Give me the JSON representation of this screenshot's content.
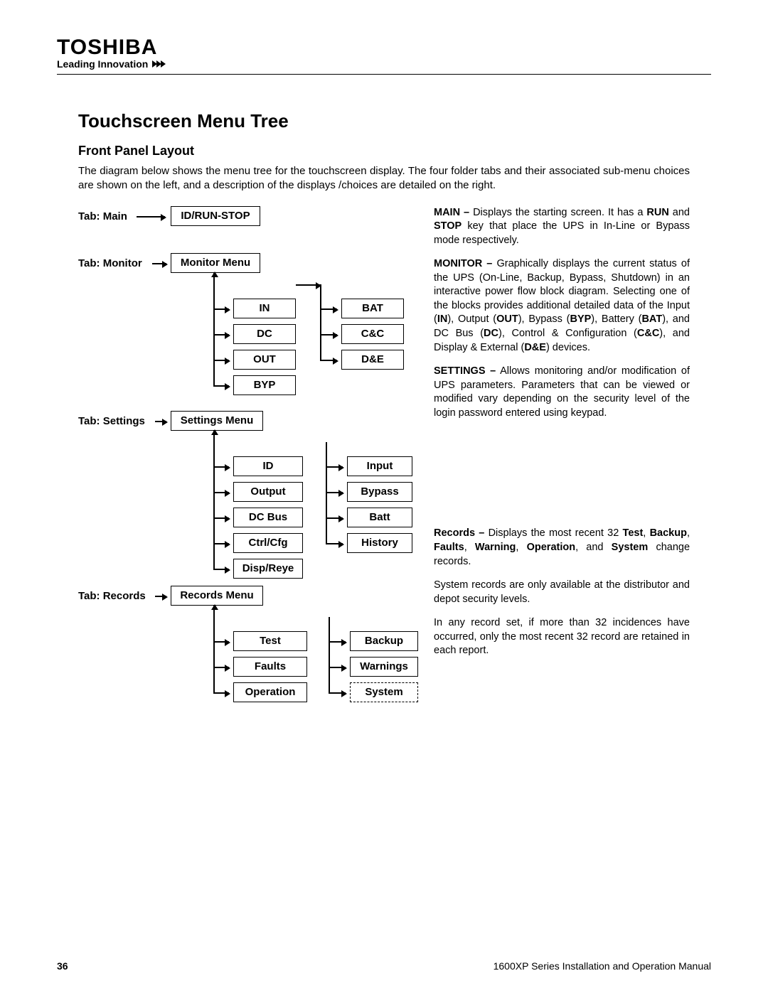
{
  "brand": "TOSHIBA",
  "tagline": "Leading Innovation",
  "title": "Touchscreen Menu Tree",
  "subtitle": "Front Panel Layout",
  "intro": "The diagram below shows the menu tree for the touchscreen display. The four folder tabs and their associated sub-menu choices are shown on the left, and a description of the displays /choices are detailed on the  right.",
  "tabs": {
    "main": {
      "label": "Tab: Main",
      "box": "ID/RUN-STOP"
    },
    "monitor": {
      "label": "Tab: Monitor",
      "box": "Monitor Menu",
      "col1": [
        "IN",
        "DC",
        "OUT",
        "BYP"
      ],
      "col2": [
        "BAT",
        "C&C",
        "D&E"
      ]
    },
    "settings": {
      "label": "Tab: Settings",
      "box": "Settings Menu",
      "col1": [
        "ID",
        "Output",
        "DC Bus",
        "Ctrl/Cfg",
        "Disp/Reye"
      ],
      "col2": [
        "Input",
        "Bypass",
        "Batt",
        "History"
      ]
    },
    "records": {
      "label": "Tab: Records",
      "box": "Records Menu",
      "col1": [
        "Test",
        "Faults",
        "Operation"
      ],
      "col2": [
        "Backup",
        "Warnings",
        "System"
      ]
    }
  },
  "desc": {
    "main_label": "MAIN –",
    "main_text": " Displays the starting screen.  It has a ",
    "main_run": "RUN",
    "main_and": " and ",
    "main_stop": "STOP",
    "main_rest": " key that place the UPS in In-Line or Bypass mode respectively.",
    "monitor_label": "MONITOR –",
    "monitor_text": " Graphically displays the current status of the UPS (On-Line, Backup, Bypass, Shutdown) in an interactive power flow block diagram. Selecting one of the blocks provides additional detailed data of the Input (",
    "in": "IN",
    "m2": "), Output (",
    "out": "OUT",
    "m3": "), Bypass (",
    "byp": "BYP",
    "m4": "), Battery (",
    "bat": "BAT",
    "m5": "), and DC Bus (",
    "dc": "DC",
    "m6": "), Control & Configuration (",
    "cc": "C&C",
    "m7": "), and Display & External (",
    "de": "D&E",
    "m8": ") devices.",
    "settings_label": "SETTINGS –",
    "settings_text": " Allows monitoring and/or modification of UPS parameters.  Parameters that can be viewed or modified vary depending on the security level of the login password entered using keypad.",
    "records_label": "Records –",
    "records_text1": " Displays the most recent 32 ",
    "r_test": "Test",
    "r_c1": ", ",
    "r_backup": "Backup",
    "r_c2": ", ",
    "r_faults": "Faults",
    "r_c3": ", ",
    "r_warning": "Warning",
    "r_c4": ", ",
    "r_operation": "Operation",
    "r_c5": ", and ",
    "r_system": "System",
    "records_text2": " change records.",
    "sys_note": "System records are only available at the distributor and depot security levels.",
    "rec_note": "In any record set, if more than 32 incidences have occurred, only the most recent 32 record are retained in each report."
  },
  "footer": {
    "page": "36",
    "doc": "1600XP Series Installation and Operation Manual"
  }
}
